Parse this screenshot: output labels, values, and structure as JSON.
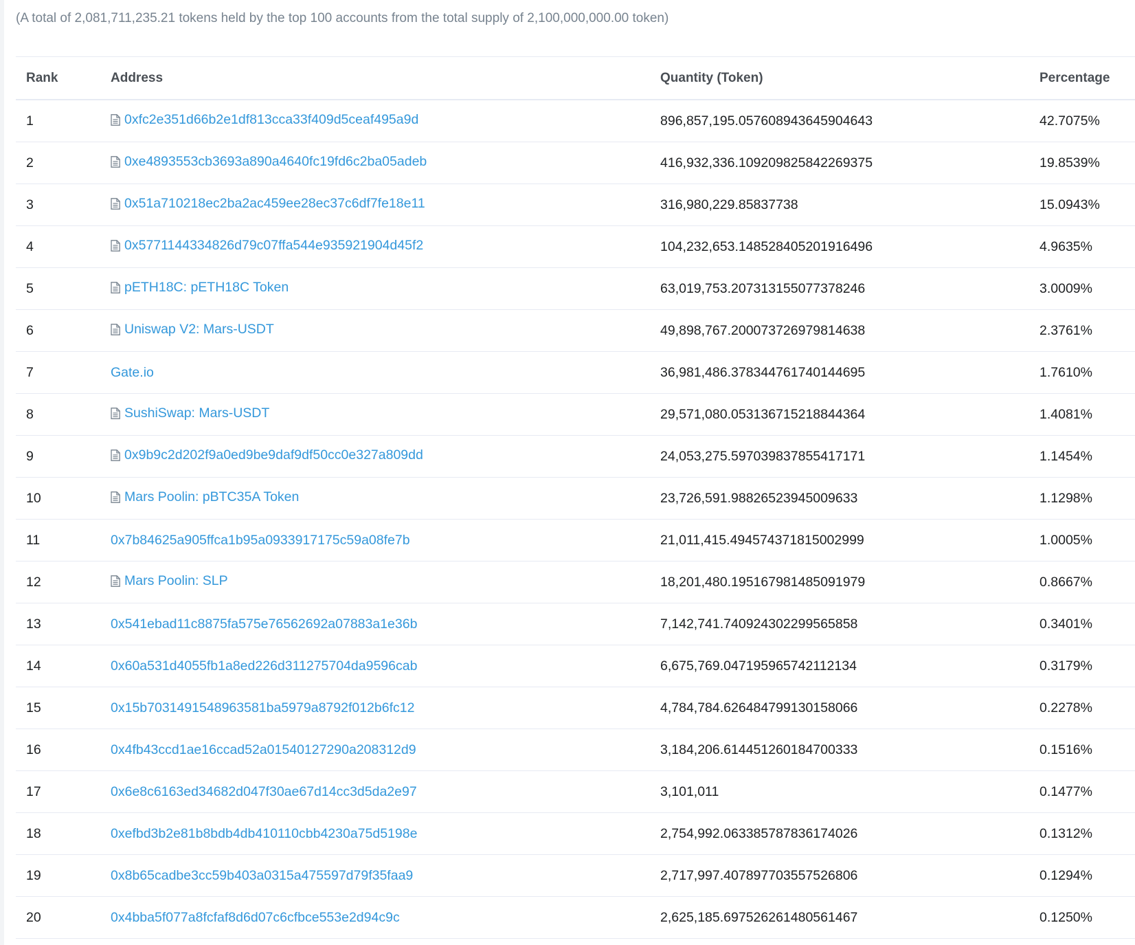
{
  "summary": "(A total of 2,081,711,235.21 tokens held by the top 100 accounts from the total supply of 2,100,000,000.00 token)",
  "table": {
    "headers": {
      "rank": "Rank",
      "address": "Address",
      "quantity": "Quantity (Token)",
      "percentage": "Percentage"
    },
    "rows": [
      {
        "rank": "1",
        "address": "0xfc2e351d66b2e1df813cca33f409d5ceaf495a9d",
        "contract": true,
        "quantity": "896,857,195.057608943645904643",
        "percentage": "42.7075%"
      },
      {
        "rank": "2",
        "address": "0xe4893553cb3693a890a4640fc19fd6c2ba05adeb",
        "contract": true,
        "quantity": "416,932,336.109209825842269375",
        "percentage": "19.8539%"
      },
      {
        "rank": "3",
        "address": "0x51a710218ec2ba2ac459ee28ec37c6df7fe18e11",
        "contract": true,
        "quantity": "316,980,229.85837738",
        "percentage": "15.0943%"
      },
      {
        "rank": "4",
        "address": "0x5771144334826d79c07ffa544e935921904d45f2",
        "contract": true,
        "quantity": "104,232,653.148528405201916496",
        "percentage": "4.9635%"
      },
      {
        "rank": "5",
        "address": "pETH18C: pETH18C Token",
        "contract": true,
        "quantity": "63,019,753.207313155077378246",
        "percentage": "3.0009%"
      },
      {
        "rank": "6",
        "address": "Uniswap V2: Mars-USDT",
        "contract": true,
        "quantity": "49,898,767.200073726979814638",
        "percentage": "2.3761%"
      },
      {
        "rank": "7",
        "address": "Gate.io",
        "contract": false,
        "quantity": "36,981,486.378344761740144695",
        "percentage": "1.7610%"
      },
      {
        "rank": "8",
        "address": "SushiSwap: Mars-USDT",
        "contract": true,
        "quantity": "29,571,080.053136715218844364",
        "percentage": "1.4081%"
      },
      {
        "rank": "9",
        "address": "0x9b9c2d202f9a0ed9be9daf9df50cc0e327a809dd",
        "contract": true,
        "quantity": "24,053,275.597039837855417171",
        "percentage": "1.1454%"
      },
      {
        "rank": "10",
        "address": "Mars Poolin: pBTC35A Token",
        "contract": true,
        "quantity": "23,726,591.98826523945009633",
        "percentage": "1.1298%"
      },
      {
        "rank": "11",
        "address": "0x7b84625a905ffca1b95a0933917175c59a08fe7b",
        "contract": false,
        "quantity": "21,011,415.494574371815002999",
        "percentage": "1.0005%"
      },
      {
        "rank": "12",
        "address": "Mars Poolin: SLP",
        "contract": true,
        "quantity": "18,201,480.195167981485091979",
        "percentage": "0.8667%"
      },
      {
        "rank": "13",
        "address": "0x541ebad11c8875fa575e76562692a07883a1e36b",
        "contract": false,
        "quantity": "7,142,741.740924302299565858",
        "percentage": "0.3401%"
      },
      {
        "rank": "14",
        "address": "0x60a531d4055fb1a8ed226d311275704da9596cab",
        "contract": false,
        "quantity": "6,675,769.047195965742112134",
        "percentage": "0.3179%"
      },
      {
        "rank": "15",
        "address": "0x15b7031491548963581ba5979a8792f012b6fc12",
        "contract": false,
        "quantity": "4,784,784.626484799130158066",
        "percentage": "0.2278%"
      },
      {
        "rank": "16",
        "address": "0x4fb43ccd1ae16ccad52a01540127290a208312d9",
        "contract": false,
        "quantity": "3,184,206.614451260184700333",
        "percentage": "0.1516%"
      },
      {
        "rank": "17",
        "address": "0x6e8c6163ed34682d047f30ae67d14cc3d5da2e97",
        "contract": false,
        "quantity": "3,101,011",
        "percentage": "0.1477%"
      },
      {
        "rank": "18",
        "address": "0xefbd3b2e81b8bdb4db410110cbb4230a75d5198e",
        "contract": false,
        "quantity": "2,754,992.063385787836174026",
        "percentage": "0.1312%"
      },
      {
        "rank": "19",
        "address": "0x8b65cadbe3cc59b403a0315a475597d79f35faa9",
        "contract": false,
        "quantity": "2,717,997.407897703557526806",
        "percentage": "0.1294%"
      },
      {
        "rank": "20",
        "address": "0x4bba5f077a8fcfaf8d6d07c6cfbce553e2d94c9c",
        "contract": false,
        "quantity": "2,625,185.697526261480561467",
        "percentage": "0.1250%"
      }
    ]
  },
  "colors": {
    "link": "#3498db",
    "text": "#1e2022",
    "muted": "#77838f",
    "border": "#e7eaf3"
  },
  "icons": {
    "contract": "file-document-icon"
  }
}
